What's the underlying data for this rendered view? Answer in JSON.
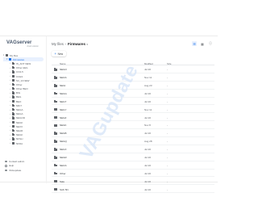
{
  "app": {
    "name": "VAGserver",
    "tagline": "cloud solution"
  },
  "sidebar": {
    "root": {
      "label": "My files"
    },
    "active": {
      "label": "Firmwares"
    },
    "items": [
      {
        "label": "IS_ANT NEW"
      },
      {
        "label": "Other AEG"
      },
      {
        "label": "CO2-5"
      },
      {
        "label": "CCE3"
      },
      {
        "label": "S3_13 NEW"
      },
      {
        "label": "Other"
      },
      {
        "label": "Other BEO"
      },
      {
        "label": "BIG"
      },
      {
        "label": "BEG"
      },
      {
        "label": "BEO"
      },
      {
        "label": "MKI7"
      },
      {
        "label": "NEGA"
      },
      {
        "label": "NEGA"
      },
      {
        "label": "NEGOD"
      },
      {
        "label": "NEGF"
      },
      {
        "label": "NEXX"
      },
      {
        "label": "NEAR"
      },
      {
        "label": "NEGF"
      },
      {
        "label": "NFSLI"
      },
      {
        "label": "NFDA"
      }
    ],
    "bottom": [
      {
        "label": "Contact admin",
        "icon": "contact-icon"
      },
      {
        "label": "Help",
        "icon": "help-icon"
      },
      {
        "label": "VAGupdate",
        "icon": "vagupdate-icon"
      }
    ]
  },
  "header": {
    "breadcrumb_root": "My files",
    "breadcrumb_current": "Firmwares",
    "new_button": "New"
  },
  "table": {
    "columns": {
      "name": "Name",
      "modified": "Modified",
      "size": "Size"
    },
    "rows": [
      {
        "name": "NEGO",
        "modified": "Jul 20",
        "size": "-"
      },
      {
        "name": "NEGS",
        "modified": "Nov 11",
        "size": "-"
      },
      {
        "name": "NEGI",
        "modified": "Aug 23",
        "size": "-"
      },
      {
        "name": "NEGG",
        "modified": "Jul 20",
        "size": "-"
      },
      {
        "name": "NEGT",
        "modified": "Jul 20",
        "size": "-"
      },
      {
        "name": "NEGY",
        "modified": "Nov 11",
        "size": "-"
      },
      {
        "name": "NEGZ",
        "modified": "Jul 20",
        "size": "-"
      },
      {
        "name": "NEGK",
        "modified": "Nov 8",
        "size": "-"
      },
      {
        "name": "NEGB",
        "modified": "Jul 20",
        "size": "-"
      },
      {
        "name": "NEGQ",
        "modified": "Aug 28",
        "size": "-"
      },
      {
        "name": "NEGX",
        "modified": "Jul 20",
        "size": "-"
      },
      {
        "name": "NEGR",
        "modified": "Jul 20",
        "size": "-"
      },
      {
        "name": "NEGS",
        "modified": "Jul 20",
        "size": "-"
      },
      {
        "name": "Other",
        "modified": "Jul 20",
        "size": "-"
      },
      {
        "name": "Sale",
        "modified": "Jul 20",
        "size": "-"
      },
      {
        "name": "SAK 5N",
        "modified": "Jul 20",
        "size": "-"
      }
    ]
  },
  "watermark": "VAGupdate",
  "colors": {
    "accent": "#1a73e8",
    "active_bg": "#e8f0fe",
    "folder": "#5f6368",
    "watermark": "#d4e3f7"
  }
}
